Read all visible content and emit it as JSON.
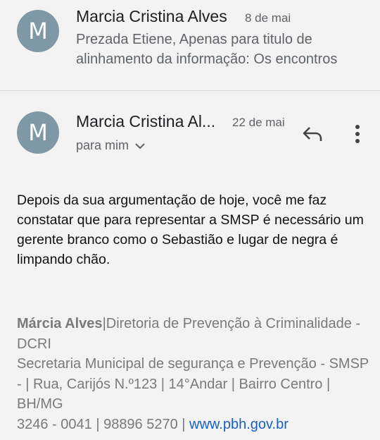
{
  "prev_message": {
    "avatar_letter": "M",
    "sender": "Marcia Cristina Alves",
    "date": "8 de mai",
    "snippet": "Prezada Etiene, Apenas para titulo de alinhamento da informação: Os encontros"
  },
  "message": {
    "avatar_letter": "M",
    "sender": "Marcia Cristina Al...",
    "date": "22 de mai",
    "recipient": "para mim",
    "reply_icon": "reply-icon",
    "more_icon": "more-vert-icon",
    "body": "Depois da sua argumentação de hoje, você me faz constatar que para representar a SMSP é necessário um gerente branco como o Sebastião e lugar de negra é limpando chão."
  },
  "signature": {
    "name": "Márcia Alves",
    "line1": "|Diretoria de Prevenção à Criminalidade - DCRI",
    "line2": "Secretaria Municipal de segurança e Prevenção - SMSP -  |  Rua, Carijós N.º123 | 14°Andar | Bairro Centro | BH/MG",
    "phones": "3246 - 0041 | 98896 5270 | ",
    "website": "www.pbh.gov.br"
  },
  "colors": {
    "avatar": "#7f98a6",
    "link": "#1a5fc4",
    "background": "#f3f3f3"
  }
}
